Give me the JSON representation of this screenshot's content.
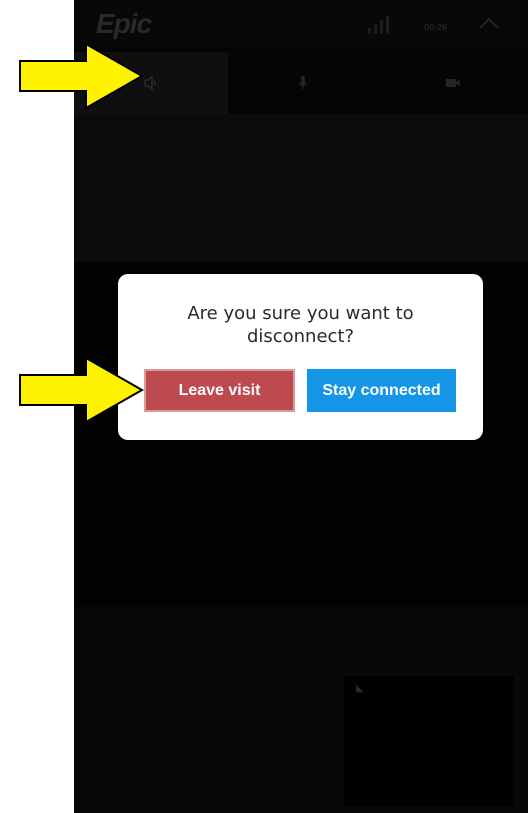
{
  "app": {
    "brand": "Epic",
    "status_time": "00:26",
    "tabs": [
      {
        "icon": "volume-icon"
      },
      {
        "icon": "microphone-icon"
      },
      {
        "icon": "camera-icon"
      }
    ]
  },
  "dialog": {
    "message": "Are you sure you want to\ndisconnect?",
    "leave_label": "Leave visit",
    "stay_label": "Stay connected"
  },
  "annotations": {
    "arrow_color": "#fff200"
  },
  "colors": {
    "background": "#040404",
    "dialog_background": "#ffffff",
    "leave_button": "#bc4a4f",
    "stay_button": "#1495e6"
  }
}
